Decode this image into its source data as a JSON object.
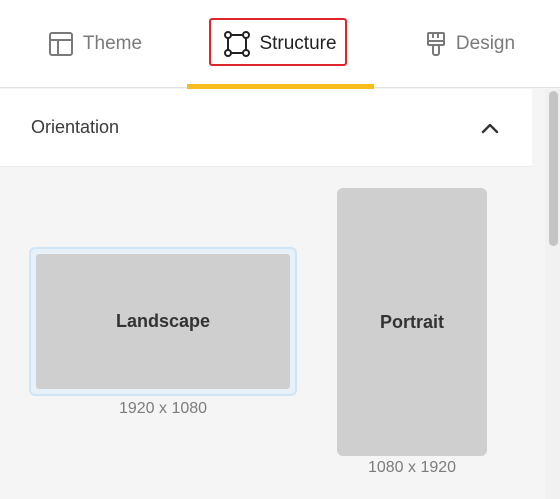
{
  "tabs": [
    {
      "label": "Theme",
      "icon": "layout-icon"
    },
    {
      "label": "Structure",
      "icon": "bounding-box-icon",
      "active": true
    },
    {
      "label": "Design",
      "icon": "paintbrush-icon"
    }
  ],
  "section": {
    "title": "Orientation",
    "toggle_icon": "chevron-up-icon",
    "expanded": true
  },
  "options": [
    {
      "label": "Landscape",
      "size": "1920 x 1080",
      "selected": true
    },
    {
      "label": "Portrait",
      "size": "1080 x 1920",
      "selected": false
    }
  ],
  "colors": {
    "accent": "#f8bc1c",
    "focus": "#e0242c",
    "selection": "#cfe5f6"
  }
}
